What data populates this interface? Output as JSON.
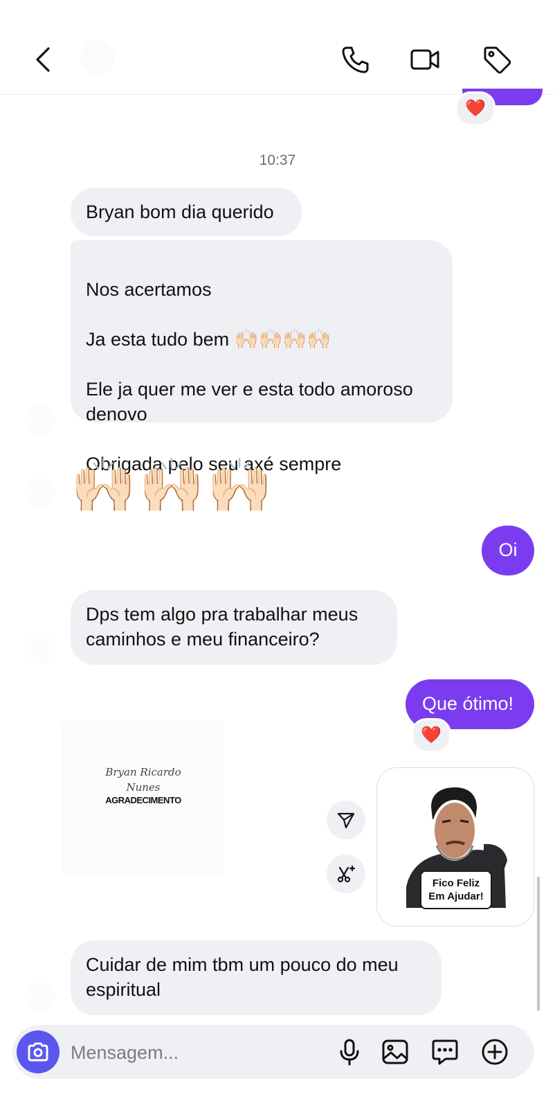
{
  "header": {
    "back_icon": "chevron-left-icon",
    "actions": [
      "phone-icon",
      "video-camera-icon",
      "tag-icon"
    ]
  },
  "reactions": {
    "heart": "❤️"
  },
  "conversation": {
    "timestamp": "10:37",
    "msg1": "Bryan bom dia querido",
    "msg2_line1": "Nos acertamos",
    "msg2_line2": "Ja esta tudo bem",
    "msg2_line2_emoji": "🙌🏻🙌🏻🙌🏻🙌🏻",
    "msg2_rest": "Ele ja quer me ver e esta todo amoroso\ndenovo\n\nObrigada pelo seu axé sempre",
    "hands_emoji": "🙌🏻",
    "msg_oi": "Oi",
    "msg3": "Dps tem algo pra trabalhar meus\ncaminhos e meu financeiro?",
    "msg_que_otimo": "Que ótimo!",
    "card": {
      "signature_line1": "Bryan Ricardo",
      "signature_line2": "Nunes",
      "title": "AGRADECIMENTO"
    },
    "sticker_caption_line1": "Fico Feliz",
    "sticker_caption_line2": "Em Ajudar!",
    "msg4": "Cuidar de mim tbm um pouco do meu\nespiritual"
  },
  "composer": {
    "placeholder": "Mensagem...",
    "icons": [
      "camera-icon",
      "microphone-icon",
      "image-icon",
      "message-icon",
      "plus-icon"
    ]
  },
  "colors": {
    "accent": "#7b3cf0",
    "incoming_bubble": "#eff0f3",
    "camera_button": "#5b57ee",
    "reaction_heart": "#e0232e"
  }
}
